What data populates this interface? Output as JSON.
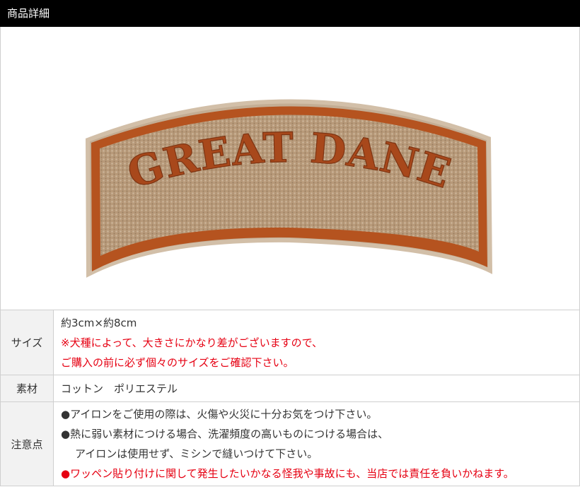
{
  "header": {
    "title": "商品詳細"
  },
  "product_image": {
    "text": "GREAT DANE"
  },
  "colors": {
    "header_bg": "#000000",
    "label_bg": "#f2f2f2",
    "warning": "#e60012",
    "patch_border": "#b5531f",
    "patch_fill": "#b89a7a"
  },
  "specs": {
    "size": {
      "label": "サイズ",
      "value": "約3cm×約8cm",
      "note1": "※犬種によって、大きさにかなり差がございますので、",
      "note2": "ご購入の前に必ず個々のサイズをご確認下さい。"
    },
    "material": {
      "label": "素材",
      "value": "コットン　ポリエステル"
    },
    "caution": {
      "label": "注意点",
      "line1": "●アイロンをご使用の際は、火傷や火災に十分お気をつけ下さい。",
      "line2": "●熱に弱い素材につける場合、洗濯頻度の高いものにつける場合は、",
      "line3": "アイロンは使用せず、ミシンで縫いつけて下さい。",
      "line4": "●ワッペン貼り付けに関して発生したいかなる怪我や事故にも、当店では責任を負いかねます。"
    }
  }
}
